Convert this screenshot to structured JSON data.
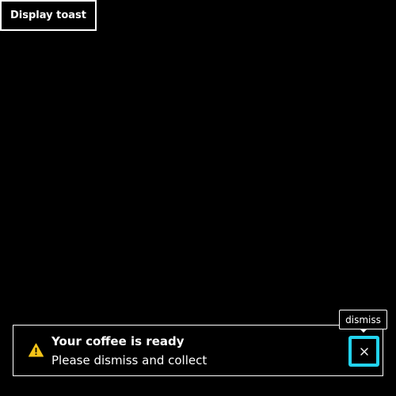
{
  "display_button": {
    "label": "Display toast"
  },
  "toast": {
    "icon": "warning-icon",
    "title": "Your coffee is ready",
    "message": "Please dismiss and collect",
    "close_icon": "close-icon",
    "close_tooltip": "dismiss"
  },
  "colors": {
    "background": "#000000",
    "foreground": "#ffffff",
    "focus_ring": "#22d3ee",
    "warning": "#f5c518"
  }
}
